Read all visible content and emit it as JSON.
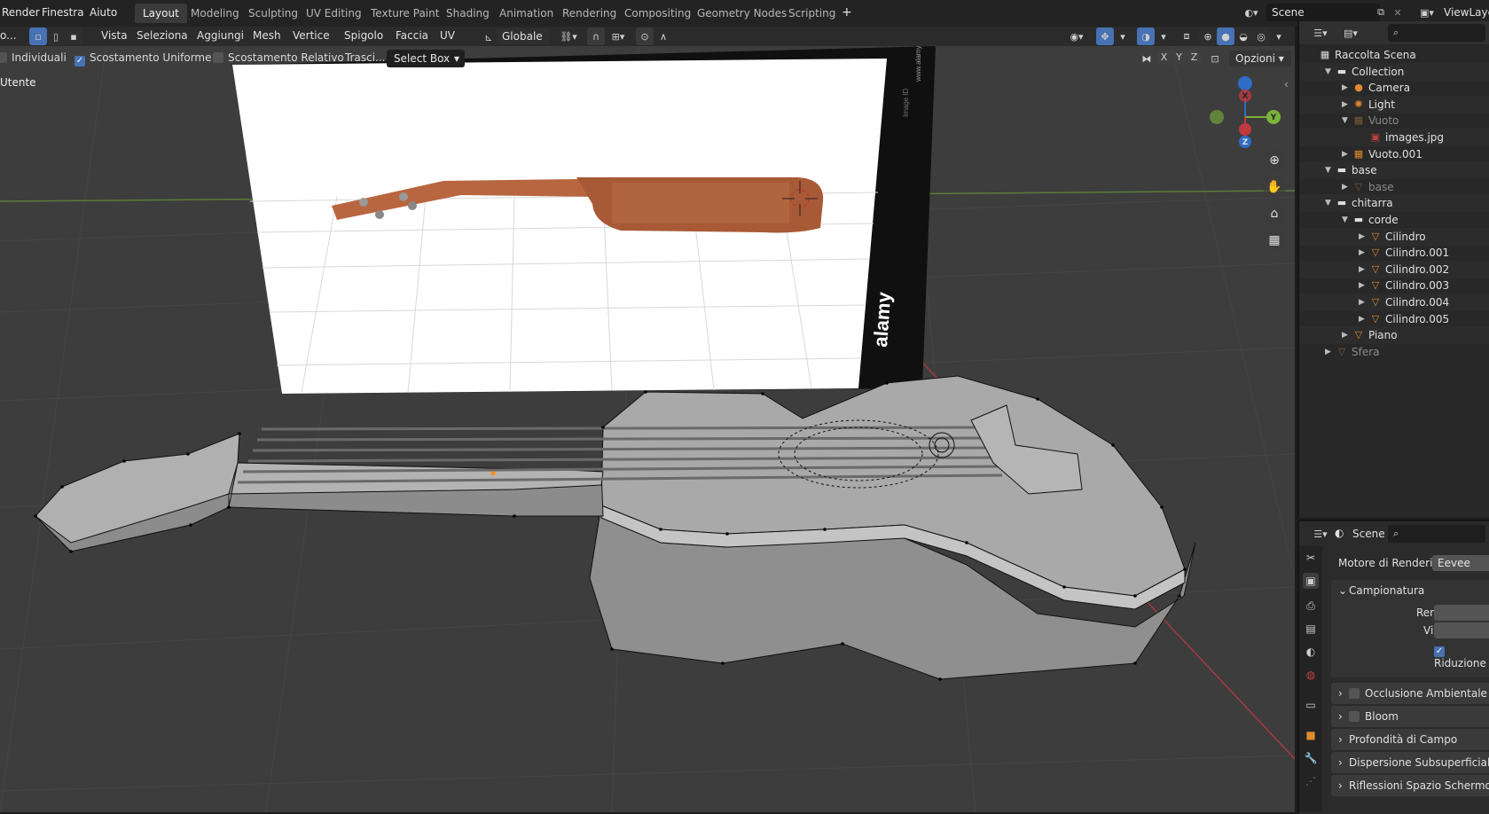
{
  "topbar": {
    "menus": [
      "Render",
      "Finestra",
      "Aiuto"
    ],
    "tabs": [
      "Layout",
      "Modeling",
      "Sculpting",
      "UV Editing",
      "Texture Paint",
      "Shading",
      "Animation",
      "Rendering",
      "Compositing",
      "Geometry Nodes",
      "Scripting"
    ],
    "active_tab": "Layout",
    "add_tab": "+",
    "scene_name": "Scene",
    "view_layer": "ViewLayer"
  },
  "header": {
    "mode_label": "o...",
    "menus": [
      "Vista",
      "Seleziona",
      "Aggiungi",
      "Mesh",
      "Vertice",
      "Spigolo",
      "Faccia",
      "UV"
    ],
    "orientation": "Globale"
  },
  "toolsettings": {
    "individuali": "Individuali",
    "scostamento_uniforme": "Scostamento Uniforme",
    "scostamento_relativo": "Scostamento Relativo",
    "trascina": "Trasci...",
    "select_box": "Select Box",
    "axes": [
      "X",
      "Y",
      "Z"
    ],
    "opzioni": "Opzioni",
    "uniforme_checked": true
  },
  "viewport": {
    "view_label": "Utente",
    "reference_image_watermark": "alamy",
    "reference_image_side_text": "Image ID",
    "reference_image_side_url": "www.alamy.com",
    "gizmo": {
      "x": "X",
      "y": "Y",
      "z": "Z"
    }
  },
  "outliner": {
    "rows": [
      {
        "label": "Raccolta Scena",
        "indent": 0,
        "icon": "scene-collection",
        "dim": false,
        "arrow": ""
      },
      {
        "label": "Collection",
        "indent": 1,
        "icon": "collection",
        "dim": false,
        "arrow": "▼"
      },
      {
        "label": "Camera",
        "indent": 2,
        "icon": "camera",
        "dim": false,
        "arrow": "▶"
      },
      {
        "label": "Light",
        "indent": 2,
        "icon": "light",
        "dim": false,
        "arrow": "▶"
      },
      {
        "label": "Vuoto",
        "indent": 2,
        "icon": "empty",
        "dim": true,
        "arrow": "▼"
      },
      {
        "label": "images.jpg",
        "indent": 3,
        "icon": "image",
        "dim": false,
        "arrow": ""
      },
      {
        "label": "Vuoto.001",
        "indent": 2,
        "icon": "empty",
        "dim": false,
        "arrow": "▶"
      },
      {
        "label": "base",
        "indent": 1,
        "icon": "collection",
        "dim": false,
        "arrow": "▼"
      },
      {
        "label": "base",
        "indent": 2,
        "icon": "mesh",
        "dim": true,
        "arrow": "▶"
      },
      {
        "label": "chitarra",
        "indent": 1,
        "icon": "collection",
        "dim": false,
        "arrow": "▼"
      },
      {
        "label": "corde",
        "indent": 2,
        "icon": "collection",
        "dim": false,
        "arrow": "▼"
      },
      {
        "label": "Cilindro",
        "indent": 3,
        "icon": "mesh",
        "dim": false,
        "arrow": "▶"
      },
      {
        "label": "Cilindro.001",
        "indent": 3,
        "icon": "mesh",
        "dim": false,
        "arrow": "▶"
      },
      {
        "label": "Cilindro.002",
        "indent": 3,
        "icon": "mesh",
        "dim": false,
        "arrow": "▶"
      },
      {
        "label": "Cilindro.003",
        "indent": 3,
        "icon": "mesh",
        "dim": false,
        "arrow": "▶"
      },
      {
        "label": "Cilindro.004",
        "indent": 3,
        "icon": "mesh",
        "dim": false,
        "arrow": "▶"
      },
      {
        "label": "Cilindro.005",
        "indent": 3,
        "icon": "mesh",
        "dim": false,
        "arrow": "▶"
      },
      {
        "label": "Piano",
        "indent": 2,
        "icon": "mesh",
        "dim": false,
        "arrow": "▶"
      },
      {
        "label": "Sfera",
        "indent": 1,
        "icon": "mesh",
        "dim": true,
        "arrow": "▶"
      }
    ]
  },
  "properties": {
    "context": "Scene",
    "render_engine_label": "Motore di Rendering",
    "render_engine_value": "Eevee",
    "sampling_panel": "Campionatura",
    "render_label": "Render",
    "viewport_label": "Vista",
    "denoise_label": "Riduzione",
    "panels": [
      "Occlusione Ambientale",
      "Bloom",
      "Profondità di Campo",
      "Dispersione Subsuperficiale",
      "Riflessioni Spazio Schermo"
    ]
  },
  "colors": {
    "accent": "#4772b3",
    "axis_x": "#c0393e",
    "axis_y": "#7ab33a",
    "axis_z": "#2f6dc7",
    "guitar_wood": "#b8663f"
  }
}
